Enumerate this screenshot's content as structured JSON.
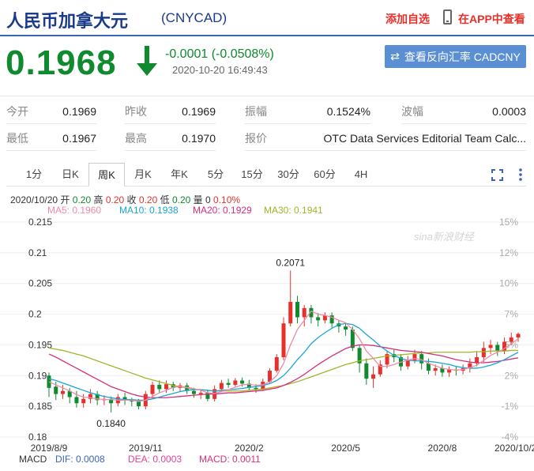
{
  "header": {
    "title": "人民币加拿大元",
    "code": "(CNYCAD)",
    "add_fav": "添加自选",
    "app_link": "在APP中查看"
  },
  "quote": {
    "price": "0.1968",
    "change": "-0.0001 (-0.0508%)",
    "time": "2020-10-20 16:49:43",
    "reverse_button": "查看反向汇率 CADCNY",
    "colors": {
      "down": "#0f8a2e",
      "up": "#e8302b"
    }
  },
  "stats": {
    "row1": [
      {
        "label": "今开",
        "value": "0.1969"
      },
      {
        "label": "昨收",
        "value": "0.1969"
      },
      {
        "label": "振幅",
        "value": "0.1524%"
      },
      {
        "label": "波幅",
        "value": "0.0003"
      }
    ],
    "row2": [
      {
        "label": "最低",
        "value": "0.1967"
      },
      {
        "label": "最高",
        "value": "0.1970"
      },
      {
        "label": "报价",
        "value": "OTC Data Services Editorial Team Calc..."
      }
    ]
  },
  "tabs": [
    "1分",
    "日K",
    "周K",
    "月K",
    "年K",
    "5分",
    "15分",
    "30分",
    "60分",
    "4H"
  ],
  "active_tab": "周K",
  "info": {
    "date": "2020/10/20",
    "items": [
      {
        "label": "开",
        "value": "0.20"
      },
      {
        "label": "高",
        "value": "0.20"
      },
      {
        "label": "收",
        "value": "0.20"
      },
      {
        "label": "低",
        "value": "0.20"
      },
      {
        "label": "量",
        "value": "0"
      },
      {
        "label": "",
        "value": "0.10%"
      }
    ]
  },
  "ma": [
    {
      "text": "MA5: 0.1960",
      "color": "#f08aa8"
    },
    {
      "text": "MA10: 0.1938",
      "color": "#1aa6d6"
    },
    {
      "text": "MA20: 0.1929",
      "color": "#d6307a"
    },
    {
      "text": "MA30: 0.1941",
      "color": "#a3b52a"
    }
  ],
  "macd": {
    "label": "MACD",
    "dif": {
      "text": "DIF: 0.0008",
      "color": "#3b63b6"
    },
    "dea": {
      "text": "DEA: 0.0003",
      "color": "#e6409a"
    },
    "macd": {
      "text": "MACD: 0.0011",
      "color": "#d6307a"
    }
  },
  "watermark": "sina新浪财经",
  "chart_data": {
    "type": "candlestick",
    "y_left_ticks": [
      "0.215",
      "0.21",
      "0.205",
      "0.2",
      "0.195",
      "0.19",
      "0.185",
      "0.18"
    ],
    "y_right_ticks": [
      "15%",
      "12%",
      "10%",
      "7%",
      "5%",
      "2%",
      "-1%",
      "-4%"
    ],
    "ylim": [
      0.18,
      0.215
    ],
    "x_labels": [
      {
        "text": "2019/8/9",
        "i": 0
      },
      {
        "text": "2019/11",
        "i": 14
      },
      {
        "text": "2020/2",
        "i": 29
      },
      {
        "text": "2020/5",
        "i": 43
      },
      {
        "text": "2020/8",
        "i": 57
      },
      {
        "text": "2020/10/20",
        "i": 68
      }
    ],
    "annotations": [
      {
        "text": "0.2071",
        "i": 35,
        "value": 0.2071
      },
      {
        "text": "0.1840",
        "i": 9,
        "value": 0.184
      }
    ],
    "candles": [
      [
        0.19,
        0.188,
        0.1905,
        0.1865
      ],
      [
        0.1882,
        0.187,
        0.189,
        0.186
      ],
      [
        0.187,
        0.1875,
        0.1885,
        0.1862
      ],
      [
        0.1875,
        0.1865,
        0.188,
        0.1855
      ],
      [
        0.1865,
        0.1855,
        0.1875,
        0.1848
      ],
      [
        0.1855,
        0.1862,
        0.187,
        0.1848
      ],
      [
        0.1862,
        0.187,
        0.1878,
        0.1855
      ],
      [
        0.187,
        0.186,
        0.1875,
        0.1852
      ],
      [
        0.186,
        0.1862,
        0.1868,
        0.1852
      ],
      [
        0.1862,
        0.1855,
        0.1866,
        0.184
      ],
      [
        0.1855,
        0.1865,
        0.187,
        0.185
      ],
      [
        0.1865,
        0.186,
        0.1872,
        0.1852
      ],
      [
        0.186,
        0.1858,
        0.1864,
        0.185
      ],
      [
        0.1858,
        0.185,
        0.1862,
        0.1845
      ],
      [
        0.185,
        0.187,
        0.1875,
        0.1845
      ],
      [
        0.187,
        0.1885,
        0.189,
        0.1865
      ],
      [
        0.1885,
        0.1878,
        0.1892,
        0.1872
      ],
      [
        0.1878,
        0.1886,
        0.1892,
        0.1872
      ],
      [
        0.1886,
        0.188,
        0.189,
        0.1875
      ],
      [
        0.188,
        0.1884,
        0.1888,
        0.1874
      ],
      [
        0.1884,
        0.1875,
        0.1888,
        0.187
      ],
      [
        0.1875,
        0.187,
        0.188,
        0.1864
      ],
      [
        0.187,
        0.1872,
        0.1878,
        0.1862
      ],
      [
        0.1872,
        0.1862,
        0.1876,
        0.1858
      ],
      [
        0.1862,
        0.1878,
        0.1884,
        0.1858
      ],
      [
        0.1878,
        0.1888,
        0.1893,
        0.1874
      ],
      [
        0.1888,
        0.1885,
        0.1895,
        0.188
      ],
      [
        0.1885,
        0.1892,
        0.1896,
        0.1882
      ],
      [
        0.1892,
        0.1887,
        0.1897,
        0.1882
      ],
      [
        0.1887,
        0.188,
        0.1893,
        0.1876
      ],
      [
        0.188,
        0.1878,
        0.1886,
        0.1872
      ],
      [
        0.1878,
        0.189,
        0.1895,
        0.1875
      ],
      [
        0.189,
        0.1908,
        0.1912,
        0.1888
      ],
      [
        0.1908,
        0.193,
        0.1935,
        0.1905
      ],
      [
        0.193,
        0.1985,
        0.1995,
        0.1925
      ],
      [
        0.1985,
        0.202,
        0.2071,
        0.198
      ],
      [
        0.202,
        0.1995,
        0.203,
        0.1985
      ],
      [
        0.1995,
        0.201,
        0.2015,
        0.198
      ],
      [
        0.201,
        0.1995,
        0.2015,
        0.1985
      ],
      [
        0.1995,
        0.199,
        0.2002,
        0.198
      ],
      [
        0.199,
        0.1998,
        0.2003,
        0.1985
      ],
      [
        0.1998,
        0.1985,
        0.2003,
        0.1978
      ],
      [
        0.1985,
        0.198,
        0.199,
        0.197
      ],
      [
        0.198,
        0.1975,
        0.1985,
        0.1965
      ],
      [
        0.1975,
        0.1945,
        0.198,
        0.194
      ],
      [
        0.1945,
        0.192,
        0.195,
        0.1905
      ],
      [
        0.192,
        0.1895,
        0.1928,
        0.1885
      ],
      [
        0.1895,
        0.1902,
        0.1915,
        0.188
      ],
      [
        0.1902,
        0.1918,
        0.1925,
        0.1898
      ],
      [
        0.1918,
        0.1935,
        0.194,
        0.1912
      ],
      [
        0.1935,
        0.193,
        0.1942,
        0.1922
      ],
      [
        0.193,
        0.1915,
        0.1935,
        0.1908
      ],
      [
        0.1915,
        0.1925,
        0.1932,
        0.191
      ],
      [
        0.1925,
        0.1935,
        0.1942,
        0.192
      ],
      [
        0.1935,
        0.192,
        0.194,
        0.191
      ],
      [
        0.192,
        0.1908,
        0.1928,
        0.1902
      ],
      [
        0.1908,
        0.1912,
        0.1918,
        0.19
      ],
      [
        0.1912,
        0.1905,
        0.1918,
        0.1898
      ],
      [
        0.1905,
        0.191,
        0.1915,
        0.1898
      ],
      [
        0.191,
        0.1908,
        0.1915,
        0.19
      ],
      [
        0.1908,
        0.1912,
        0.1918,
        0.1902
      ],
      [
        0.1912,
        0.192,
        0.1928,
        0.1905
      ],
      [
        0.192,
        0.193,
        0.194,
        0.1915
      ],
      [
        0.193,
        0.1945,
        0.1955,
        0.1922
      ],
      [
        0.1945,
        0.195,
        0.1958,
        0.1935
      ],
      [
        0.195,
        0.194,
        0.1955,
        0.1932
      ],
      [
        0.194,
        0.1955,
        0.1962,
        0.1935
      ],
      [
        0.1955,
        0.1962,
        0.197,
        0.195
      ],
      [
        0.1962,
        0.1968,
        0.197,
        0.1955
      ]
    ],
    "ma5": [
      0.189,
      0.1885,
      0.188,
      0.1875,
      0.1869,
      0.1865,
      0.1864,
      0.1862,
      0.1861,
      0.1861,
      0.186,
      0.186,
      0.186,
      0.1858,
      0.186,
      0.1866,
      0.1872,
      0.1876,
      0.1881,
      0.1882,
      0.1881,
      0.1879,
      0.1876,
      0.1872,
      0.1871,
      0.1874,
      0.1877,
      0.1881,
      0.1885,
      0.1886,
      0.1884,
      0.1885,
      0.189,
      0.19,
      0.192,
      0.195,
      0.1975,
      0.199,
      0.2005,
      0.2,
      0.1998,
      0.1995,
      0.199,
      0.1986,
      0.1975,
      0.196,
      0.194,
      0.1928,
      0.1915,
      0.1915,
      0.1918,
      0.1922,
      0.1925,
      0.1928,
      0.1926,
      0.192,
      0.1916,
      0.1912,
      0.191,
      0.1909,
      0.191,
      0.1913,
      0.1917,
      0.1925,
      0.1933,
      0.1938,
      0.1944,
      0.1952,
      0.196
    ],
    "ma10": [
      0.1895,
      0.1892,
      0.1888,
      0.1884,
      0.188,
      0.1876,
      0.1872,
      0.1869,
      0.1866,
      0.1864,
      0.1862,
      0.1861,
      0.1861,
      0.186,
      0.186,
      0.1862,
      0.1865,
      0.1868,
      0.1871,
      0.1874,
      0.1876,
      0.1877,
      0.1877,
      0.1876,
      0.1875,
      0.1876,
      0.1877,
      0.1878,
      0.1879,
      0.1881,
      0.1882,
      0.1884,
      0.1887,
      0.1892,
      0.19,
      0.1912,
      0.1926,
      0.1938,
      0.1952,
      0.1962,
      0.197,
      0.1977,
      0.1983,
      0.1985,
      0.1983,
      0.1977,
      0.1967,
      0.1958,
      0.1948,
      0.194,
      0.1933,
      0.1928,
      0.1925,
      0.1924,
      0.1924,
      0.1923,
      0.1922,
      0.192,
      0.1918,
      0.1915,
      0.1913,
      0.1912,
      0.1912,
      0.1914,
      0.1917,
      0.1921,
      0.1926,
      0.1932,
      0.1938
    ],
    "ma20": [
      0.1935,
      0.193,
      0.1924,
      0.1918,
      0.1912,
      0.1906,
      0.19,
      0.1894,
      0.1888,
      0.1882,
      0.1878,
      0.1874,
      0.187,
      0.1867,
      0.1865,
      0.1864,
      0.1864,
      0.1864,
      0.1865,
      0.1866,
      0.1867,
      0.1868,
      0.1869,
      0.187,
      0.187,
      0.1871,
      0.1872,
      0.1872,
      0.1873,
      0.1874,
      0.1875,
      0.1876,
      0.1878,
      0.188,
      0.1884,
      0.1889,
      0.1895,
      0.1902,
      0.191,
      0.1918,
      0.1925,
      0.1932,
      0.1938,
      0.1944,
      0.1948,
      0.195,
      0.195,
      0.1949,
      0.1947,
      0.1945,
      0.1943,
      0.1941,
      0.194,
      0.1939,
      0.1938,
      0.1936,
      0.1934,
      0.1932,
      0.1929,
      0.1926,
      0.1924,
      0.1922,
      0.1921,
      0.1921,
      0.1922,
      0.1923,
      0.1925,
      0.1927,
      0.1929
    ],
    "ma30": [
      0.1945,
      0.1943,
      0.1941,
      0.1938,
      0.1935,
      0.1932,
      0.1928,
      0.1924,
      0.192,
      0.1916,
      0.1912,
      0.1908,
      0.1904,
      0.19,
      0.1896,
      0.1893,
      0.189,
      0.1887,
      0.1884,
      0.1882,
      0.188,
      0.1878,
      0.1877,
      0.1876,
      0.1875,
      0.1875,
      0.1875,
      0.1875,
      0.1875,
      0.1876,
      0.1877,
      0.1878,
      0.188,
      0.1882,
      0.1884,
      0.1887,
      0.189,
      0.1894,
      0.1898,
      0.1902,
      0.1906,
      0.191,
      0.1914,
      0.1918,
      0.1921,
      0.1924,
      0.1926,
      0.1928,
      0.193,
      0.1932,
      0.1933,
      0.1934,
      0.1935,
      0.1936,
      0.1937,
      0.1937,
      0.1938,
      0.1938,
      0.1938,
      0.1938,
      0.1938,
      0.1938,
      0.1939,
      0.1939,
      0.194,
      0.194,
      0.194,
      0.1941,
      0.1941
    ]
  }
}
